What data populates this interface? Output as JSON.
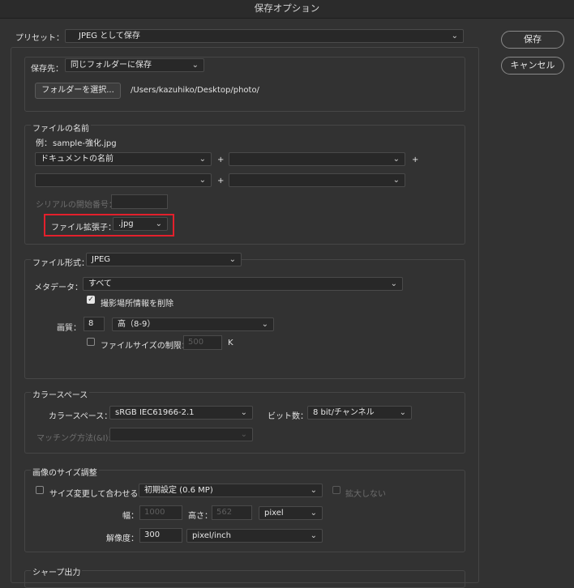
{
  "window": {
    "title": "保存オプション"
  },
  "preset": {
    "label": "プリセット：",
    "value": "JPEG として保存"
  },
  "actions": {
    "save_label": "保存",
    "cancel_label": "キャンセル"
  },
  "destination": {
    "label": "保存先：",
    "value": "同じフォルダーに保存",
    "choose_folder_label": "フォルダーを選択...",
    "path": "/Users/kazuhiko/Desktop/photo/"
  },
  "filename": {
    "section_title": "ファイルの名前",
    "example_label": "例：",
    "example_value": "sample-強化.jpg",
    "field1": "ドキュメントの名前",
    "field2": "",
    "field3": "",
    "field4": "",
    "plus": "+",
    "serial_label": "シリアルの開始番号：",
    "serial_value": "",
    "extension_label": "ファイル拡張子：",
    "extension_value": ".jpg"
  },
  "format": {
    "label": "ファイル形式：",
    "value": "JPEG",
    "metadata_label": "メタデータ：",
    "metadata_value": "すべて",
    "remove_location_label": "撮影場所情報を削除",
    "remove_location_checked": true,
    "quality_label": "画質：",
    "quality_value": "8",
    "quality_preset": "高（8-9）",
    "limit_size_label": "ファイルサイズの制限：",
    "limit_size_checked": false,
    "limit_size_value": "500",
    "limit_size_unit": "K"
  },
  "colorspace": {
    "section_title": "カラースペース",
    "label": "カラースペース：",
    "value": "sRGB IEC61966-2.1",
    "bit_label": "ビット数：",
    "bit_value": "8 bit/チャンネル",
    "matching_label": "マッチング方法(&I):",
    "matching_value": ""
  },
  "resize": {
    "section_title": "画像のサイズ調整",
    "fit_label": "サイズ変更して合わせる：",
    "fit_checked": false,
    "fit_value": "初期設定 (0.6 MP)",
    "no_enlarge_label": "拡大しない",
    "width_label": "幅：",
    "width_value": "1000",
    "height_label": "高さ：",
    "height_value": "562",
    "unit_value": "pixel",
    "resolution_label": "解像度：",
    "resolution_value": "300",
    "resolution_unit": "pixel/inch"
  },
  "sharpen": {
    "section_title": "シャープ出力"
  },
  "icons": {
    "dropdown": "chevron-down-icon",
    "check": "checkmark-icon"
  },
  "colors": {
    "background": "#323232",
    "highlight": "#e3202c"
  }
}
